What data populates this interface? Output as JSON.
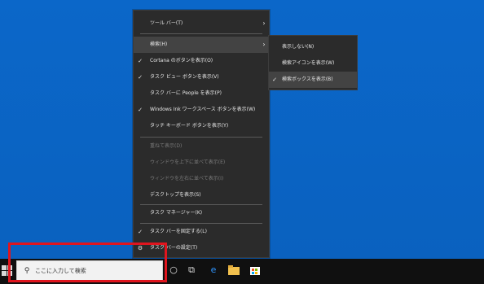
{
  "menu": {
    "items": [
      {
        "label": "ツール バー(T)",
        "check": "",
        "arrow": "›",
        "state": "normal"
      },
      {
        "label": "検索(H)",
        "check": "",
        "arrow": "›",
        "state": "highlight"
      },
      {
        "label": "Cortana のボタンを表示(O)",
        "check": "✓",
        "arrow": "",
        "state": "normal"
      },
      {
        "label": "タスク ビュー ボタンを表示(V)",
        "check": "✓",
        "arrow": "",
        "state": "normal"
      },
      {
        "label": "タスク バーに People を表示(P)",
        "check": "",
        "arrow": "",
        "state": "normal"
      },
      {
        "label": "Windows Ink ワークスペース ボタンを表示(W)",
        "check": "✓",
        "arrow": "",
        "state": "normal"
      },
      {
        "label": "タッチ キーボード ボタンを表示(Y)",
        "check": "",
        "arrow": "",
        "state": "normal"
      },
      {
        "label": "重ねて表示(D)",
        "check": "",
        "arrow": "",
        "state": "disabled"
      },
      {
        "label": "ウィンドウを上下に並べて表示(E)",
        "check": "",
        "arrow": "",
        "state": "disabled"
      },
      {
        "label": "ウィンドウを左右に並べて表示(I)",
        "check": "",
        "arrow": "",
        "state": "disabled"
      },
      {
        "label": "デスクトップを表示(S)",
        "check": "",
        "arrow": "",
        "state": "normal"
      },
      {
        "label": "タスク マネージャー(K)",
        "check": "",
        "arrow": "",
        "state": "normal"
      },
      {
        "label": "タスク バーを固定する(L)",
        "check": "✓",
        "arrow": "",
        "state": "normal"
      },
      {
        "label": "タスク バーの設定(T)",
        "check": "⚙",
        "arrow": "",
        "state": "normal"
      }
    ]
  },
  "submenu": {
    "items": [
      {
        "label": "表示しない(N)",
        "check": "",
        "state": "normal"
      },
      {
        "label": "検索アイコンを表示(W)",
        "check": "",
        "state": "normal"
      },
      {
        "label": "検索ボックスを表示(B)",
        "check": "✓",
        "state": "highlight"
      }
    ]
  },
  "taskbar": {
    "search_placeholder": "ここに入力して検索",
    "search_icon": "search-icon",
    "icons": [
      "cortana-icon",
      "task-view-icon",
      "edge-icon",
      "file-explorer-icon",
      "store-icon"
    ]
  },
  "colors": {
    "desktop": "#0a64c8",
    "menu_bg": "#2b2b2b",
    "highlight_bg": "#434343",
    "taskbar_bg": "#101010",
    "annotation_red": "#e0151e"
  }
}
